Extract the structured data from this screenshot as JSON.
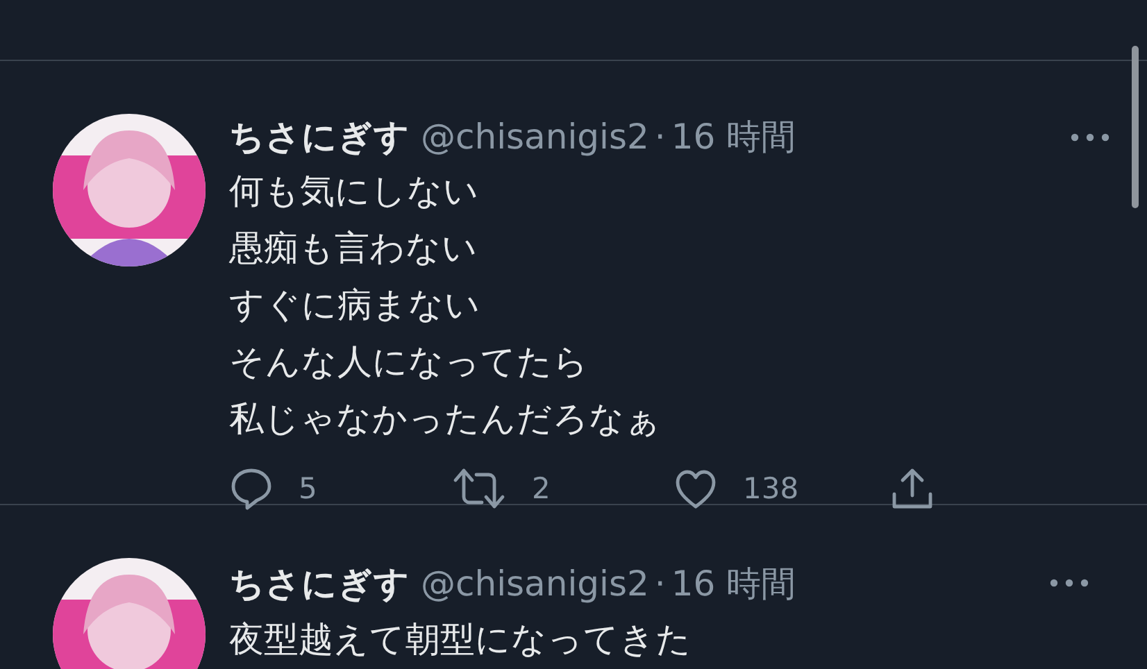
{
  "tweets": [
    {
      "name": "ちさにぎす",
      "handle": "@chisanigis2",
      "separator": "·",
      "time": "16 時間",
      "lines": [
        "何も気にしない",
        "愚痴も言わない",
        "すぐに病まない",
        "そんな人になってたら",
        "私じゃなかったんだろなぁ"
      ],
      "actions": [
        {
          "kind": "reply",
          "count": "5"
        },
        {
          "kind": "retweet",
          "count": "2"
        },
        {
          "kind": "like",
          "count": "138"
        },
        {
          "kind": "share"
        }
      ]
    },
    {
      "name": "ちさにぎす",
      "handle": "@chisanigis2",
      "separator": "·",
      "time": "16 時間",
      "lines": [
        "夜型越えて朝型になってきた"
      ]
    }
  ]
}
